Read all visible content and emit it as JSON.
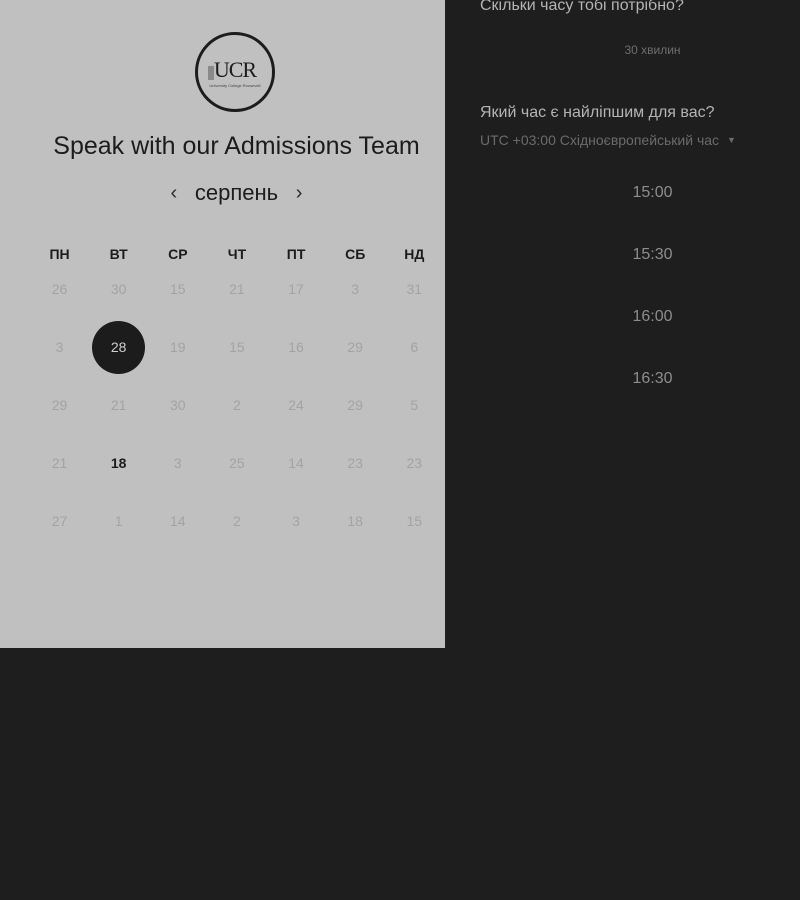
{
  "logo": {
    "text": "UCR",
    "subtitle": "University College Roosevelt"
  },
  "title": "Speak with our Admissions Team",
  "calendar": {
    "month": "серпень",
    "weekdays": [
      "ПН",
      "ВТ",
      "СР",
      "ЧТ",
      "ПТ",
      "СБ",
      "НД"
    ],
    "weeks": [
      [
        "26",
        "30",
        "15",
        "21",
        "17",
        "3",
        "31"
      ],
      [
        "3",
        "28",
        "19",
        "15",
        "16",
        "29",
        "6"
      ],
      [
        "29",
        "21",
        "30",
        "2",
        "24",
        "29",
        "5"
      ],
      [
        "21",
        "18",
        "3",
        "25",
        "14",
        "23",
        "23"
      ],
      [
        "27",
        "1",
        "14",
        "2",
        "3",
        "18",
        "15"
      ]
    ],
    "selected": "28",
    "available": [
      "18"
    ]
  },
  "booking": {
    "duration_question": "Скільки часу тобі потрібно?",
    "duration_value": "30 хвилин",
    "time_question": "Який час є найліпшим для вас?",
    "timezone": "UTC +03:00 Східноєвропейський час",
    "slots": [
      "15:00",
      "15:30",
      "16:00",
      "16:30"
    ]
  }
}
